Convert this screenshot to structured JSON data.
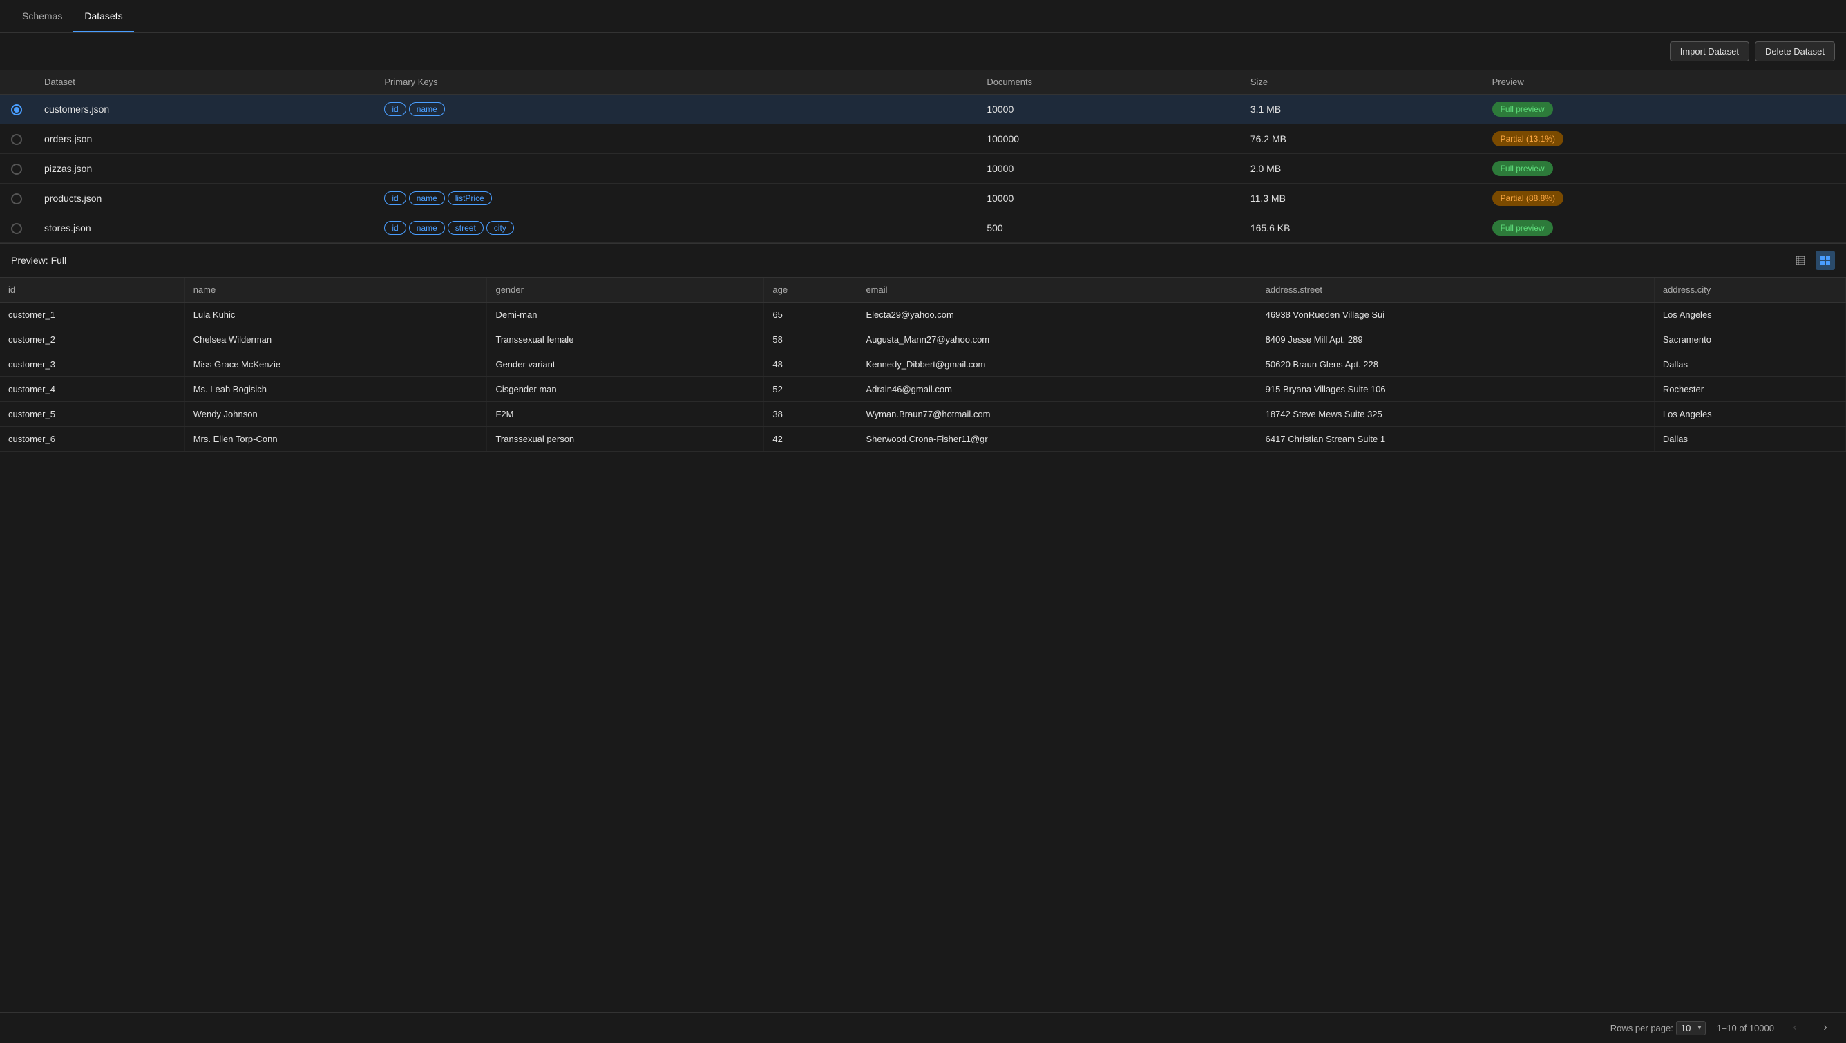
{
  "nav": {
    "tabs": [
      {
        "id": "schemas",
        "label": "Schemas",
        "active": false
      },
      {
        "id": "datasets",
        "label": "Datasets",
        "active": true
      }
    ]
  },
  "toolbar": {
    "import_label": "Import Dataset",
    "delete_label": "Delete Dataset"
  },
  "datasets_table": {
    "columns": [
      "",
      "Dataset",
      "Primary Keys",
      "Documents",
      "Size",
      "Preview"
    ],
    "rows": [
      {
        "id": "customers.json",
        "name": "customers.json",
        "keys": [
          "id",
          "name"
        ],
        "documents": "10000",
        "size": "3.1 MB",
        "preview_label": "Full preview",
        "preview_type": "full",
        "selected": true
      },
      {
        "id": "orders.json",
        "name": "orders.json",
        "keys": [],
        "documents": "100000",
        "size": "76.2 MB",
        "preview_label": "Partial (13.1%)",
        "preview_type": "partial",
        "selected": false
      },
      {
        "id": "pizzas.json",
        "name": "pizzas.json",
        "keys": [],
        "documents": "10000",
        "size": "2.0 MB",
        "preview_label": "Full preview",
        "preview_type": "full",
        "selected": false
      },
      {
        "id": "products.json",
        "name": "products.json",
        "keys": [
          "id",
          "name",
          "listPrice"
        ],
        "documents": "10000",
        "size": "11.3 MB",
        "preview_label": "Partial (88.8%)",
        "preview_type": "partial",
        "selected": false
      },
      {
        "id": "stores.json",
        "name": "stores.json",
        "keys": [
          "id",
          "name",
          "street",
          "city"
        ],
        "documents": "500",
        "size": "165.6 KB",
        "preview_label": "Full preview",
        "preview_type": "full",
        "selected": false
      }
    ]
  },
  "preview": {
    "title": "Preview: Full",
    "columns": [
      "id",
      "name",
      "gender",
      "age",
      "email",
      "address.street",
      "address.city"
    ],
    "rows": [
      {
        "id": "customer_1",
        "name": "Lula Kuhic",
        "gender": "Demi-man",
        "age": "65",
        "email": "Electa29@yahoo.com",
        "address_street": "46938 VonRueden Village Sui",
        "address_city": "Los Angeles"
      },
      {
        "id": "customer_2",
        "name": "Chelsea Wilderman",
        "gender": "Transsexual female",
        "age": "58",
        "email": "Augusta_Mann27@yahoo.com",
        "address_street": "8409 Jesse Mill Apt. 289",
        "address_city": "Sacramento"
      },
      {
        "id": "customer_3",
        "name": "Miss Grace McKenzie",
        "gender": "Gender variant",
        "age": "48",
        "email": "Kennedy_Dibbert@gmail.com",
        "address_street": "50620 Braun Glens Apt. 228",
        "address_city": "Dallas"
      },
      {
        "id": "customer_4",
        "name": "Ms. Leah Bogisich",
        "gender": "Cisgender man",
        "age": "52",
        "email": "Adrain46@gmail.com",
        "address_street": "915 Bryana Villages Suite 106",
        "address_city": "Rochester"
      },
      {
        "id": "customer_5",
        "name": "Wendy Johnson",
        "gender": "F2M",
        "age": "38",
        "email": "Wyman.Braun77@hotmail.com",
        "address_street": "18742 Steve Mews Suite 325",
        "address_city": "Los Angeles"
      },
      {
        "id": "customer_6",
        "name": "Mrs. Ellen Torp-Conn",
        "gender": "Transsexual person",
        "age": "42",
        "email": "Sherwood.Crona-Fisher11@gr",
        "address_street": "6417 Christian Stream Suite 1",
        "address_city": "Dallas"
      }
    ],
    "pagination": {
      "rows_per_page_label": "Rows per page:",
      "rows_per_page_value": "10",
      "range_label": "1–10 of 10000"
    }
  }
}
